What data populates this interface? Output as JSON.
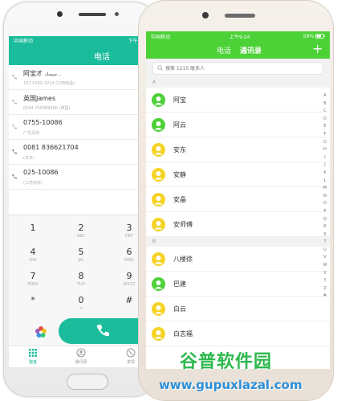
{
  "left_phone": {
    "status": {
      "carrier": "中国移动",
      "time": "下午4:29"
    },
    "header_title": "电话",
    "calls": [
      {
        "name": "阿宝才",
        "name_extra": "سيمك...",
        "sub": "187-0269-3214 (江西南昌)"
      },
      {
        "name": "英国James",
        "sub": "0044 795986666 (英国)"
      },
      {
        "name": "0755-10086",
        "sub": "广东深圳"
      },
      {
        "name": "0081 836621704",
        "sub": "(日本)"
      },
      {
        "name": "025-10086",
        "sub": "(江苏南京)"
      }
    ],
    "keys": [
      {
        "num": "1",
        "letters": ""
      },
      {
        "num": "2",
        "letters": "ABC"
      },
      {
        "num": "3",
        "letters": "DEF"
      },
      {
        "num": "4",
        "letters": "GHI"
      },
      {
        "num": "5",
        "letters": "JKL"
      },
      {
        "num": "6",
        "letters": "MNO"
      },
      {
        "num": "7",
        "letters": "PQRS"
      },
      {
        "num": "8",
        "letters": "TUV"
      },
      {
        "num": "9",
        "letters": "WXYZ"
      },
      {
        "num": "*",
        "letters": ""
      },
      {
        "num": "0",
        "letters": "+"
      },
      {
        "num": "#",
        "letters": ""
      }
    ],
    "tabs": [
      {
        "label": "键盘",
        "icon": "dialpad-icon"
      },
      {
        "label": "通讯录",
        "icon": "contacts-icon"
      },
      {
        "label": "发现",
        "icon": "discover-icon"
      }
    ],
    "accent": "#1abc9c"
  },
  "right_phone": {
    "status": {
      "carrier": "中国移动",
      "time": "上午9:24",
      "battery": "59%"
    },
    "tabs": {
      "phone": "电话",
      "contacts": "通讯录"
    },
    "add_label": "+",
    "search_placeholder": "搜索 1215 联系人",
    "sections": [
      {
        "letter": "A",
        "contacts": [
          "阿宝",
          "阿云",
          "安东",
          "安静",
          "安晶",
          "安师傅"
        ]
      },
      {
        "letter": "B",
        "contacts": [
          "八楼徐",
          "巴建",
          "白云",
          "白志福"
        ]
      }
    ],
    "index_letters": [
      "A",
      "B",
      "C",
      "D",
      "E",
      "F",
      "G",
      "H",
      "I",
      "J",
      "K",
      "L",
      "M",
      "N",
      "O",
      "P",
      "Q",
      "R",
      "S",
      "T",
      "U",
      "V",
      "W",
      "X",
      "Y",
      "Z",
      "#"
    ],
    "accent": "#4cd137",
    "avatar_colors": [
      "#4cd137",
      "#f5d327"
    ]
  },
  "watermark": {
    "logo": "谷普软件园",
    "url": "www.gupuxlazal.com"
  }
}
